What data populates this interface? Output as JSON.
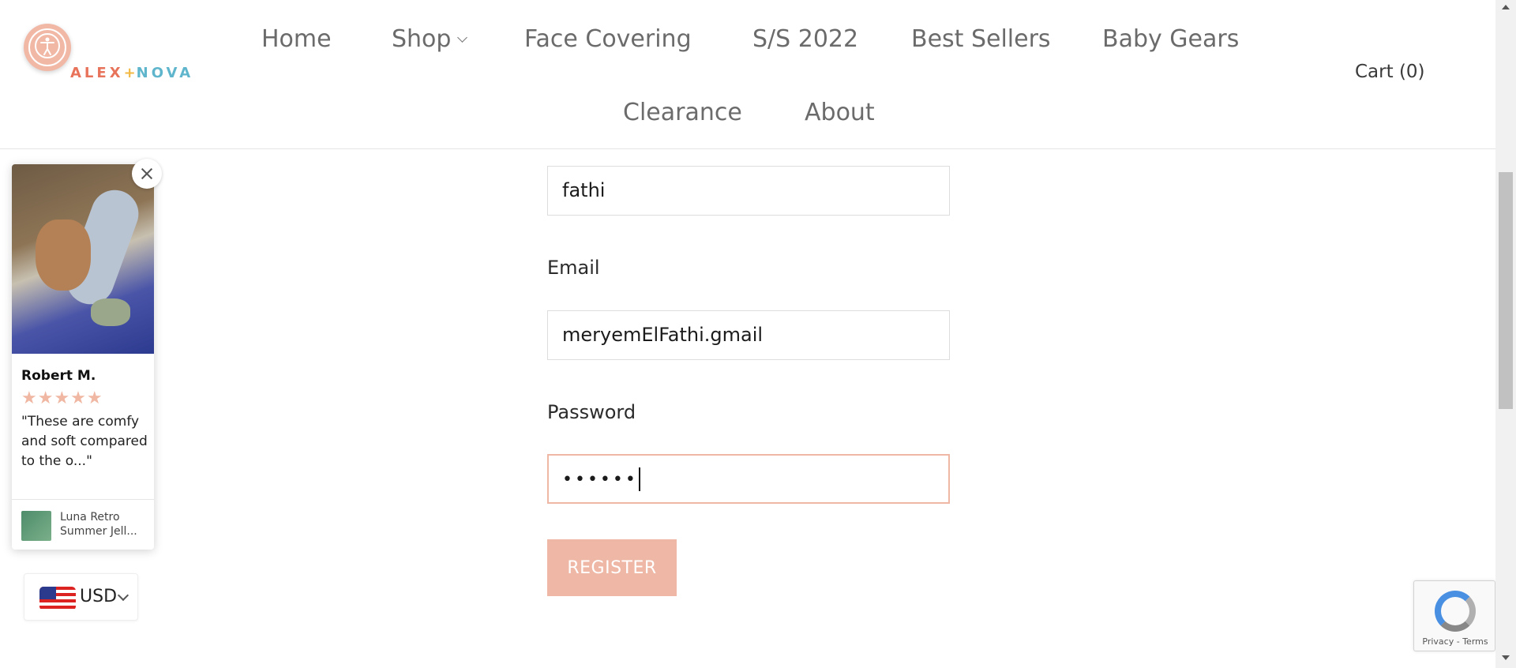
{
  "header": {
    "logo": {
      "part1": "ALEX",
      "plus": "+",
      "part2": "NOVA"
    },
    "nav": [
      {
        "label": "Home"
      },
      {
        "label": "Shop",
        "has_dropdown": true
      },
      {
        "label": "Face Covering"
      },
      {
        "label": "S/S 2022"
      },
      {
        "label": "Best Sellers"
      },
      {
        "label": "Baby Gears"
      },
      {
        "label": "Clearance"
      },
      {
        "label": "About"
      }
    ],
    "cart_label": "Cart (0)"
  },
  "form": {
    "name_value": "fathi",
    "email_label": "Email",
    "email_value": "meryemElFathi.gmail",
    "password_label": "Password",
    "password_masked": "••••••",
    "register_label": "REGISTER"
  },
  "review_popup": {
    "reviewer": "Robert M.",
    "stars": "★★★★★",
    "rating": 5,
    "text": "\"These are comfy and soft compared to the o...\"",
    "product_name": "Luna Retro Summer Jell..."
  },
  "currency": {
    "label": "USD"
  },
  "recaptcha": {
    "links": "Privacy - Terms"
  },
  "colors": {
    "accent": "#efb8a6",
    "logo_orange": "#e8735b",
    "logo_blue": "#5fb6cc",
    "nav_text": "#6b6b6b"
  },
  "icons": {
    "accessibility": "accessibility-icon",
    "close": "close-icon",
    "chevron": "chevron-down-icon",
    "flag": "us-flag-icon",
    "recaptcha": "recaptcha-icon"
  }
}
